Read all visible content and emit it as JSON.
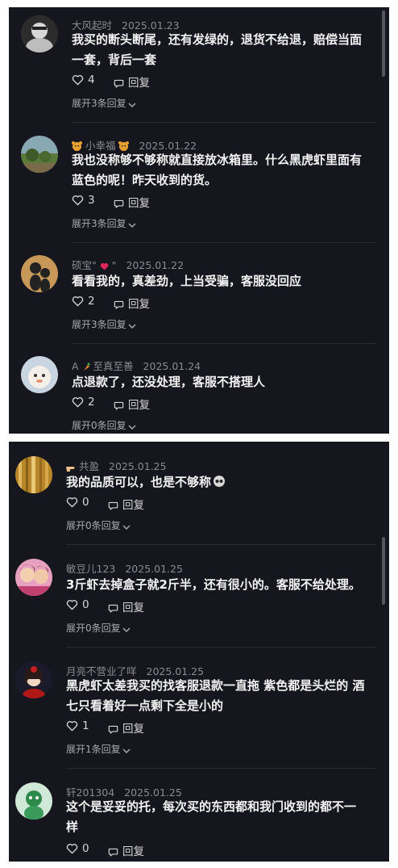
{
  "panel1": {
    "comments": [
      {
        "user": "大风起时",
        "date": "2025.01.23",
        "line1": "我买的断头断尾，还有发绿的，退货不给退，赔偿当面",
        "line2": "一套，背后一套",
        "likes": "4",
        "reply": "回复",
        "expand": "展开3条回复"
      },
      {
        "user": "小幸福",
        "date": "2025.01.22",
        "line1": "我也没称够不够称就直接放冰箱里。什么黑虎虾里面有",
        "line2": "蓝色的呢！昨天收到的货。",
        "likes": "3",
        "reply": "回复",
        "expand": "展开3条回复"
      },
      {
        "user": "硕宝\"",
        "user_suffix": "\"",
        "date": "2025.01.22",
        "line1": "看看我的，真差劲，上当受骗，客服没回应",
        "likes": "2",
        "reply": "回复",
        "expand": "展开3条回复"
      },
      {
        "user": "A",
        "user_suffix": "至真至善",
        "date": "2025.01.24",
        "line1": "点退款了，还没处理，客服不搭理人",
        "likes": "2",
        "reply": "回复",
        "expand": "展开0条回复"
      }
    ]
  },
  "panel2": {
    "comments": [
      {
        "user": "共盈",
        "date": "2025.01.25",
        "line1": "我的品质可以，也是不够称",
        "likes": "0",
        "reply": "回复",
        "expand": "展开0条回复"
      },
      {
        "user": "敏豆儿123",
        "date": "2025.01.25",
        "line1": "3斤虾去掉盒子就2斤半，还有很小的。客服不给处理。",
        "likes": "0",
        "reply": "回复",
        "expand": "展开0条回复"
      },
      {
        "user": "月亮不营业了咩",
        "date": "2025.01.25",
        "line1": "黑虎虾太差我买的找客服退款一直拖 紫色都是头烂的 酒",
        "line2": "七只看着好一点剩下全是小的",
        "likes": "1",
        "reply": "回复",
        "expand": "展开1条回复"
      },
      {
        "user": "轩201304",
        "date": "2025.01.25",
        "line1": "这个是妥妥的托，每次买的东西都和我门收到的都不一",
        "line2": "样",
        "likes": "0",
        "reply": "回复"
      }
    ]
  },
  "icons": {
    "like": "heart-outline-icon",
    "reply": "speech-bubble-icon",
    "expand": "chevron-down-icon"
  },
  "colors": {
    "background": "#16161e",
    "text": "#f2f2f2",
    "meta": "#8a8a92",
    "heart_emoji": "#e0245e"
  }
}
